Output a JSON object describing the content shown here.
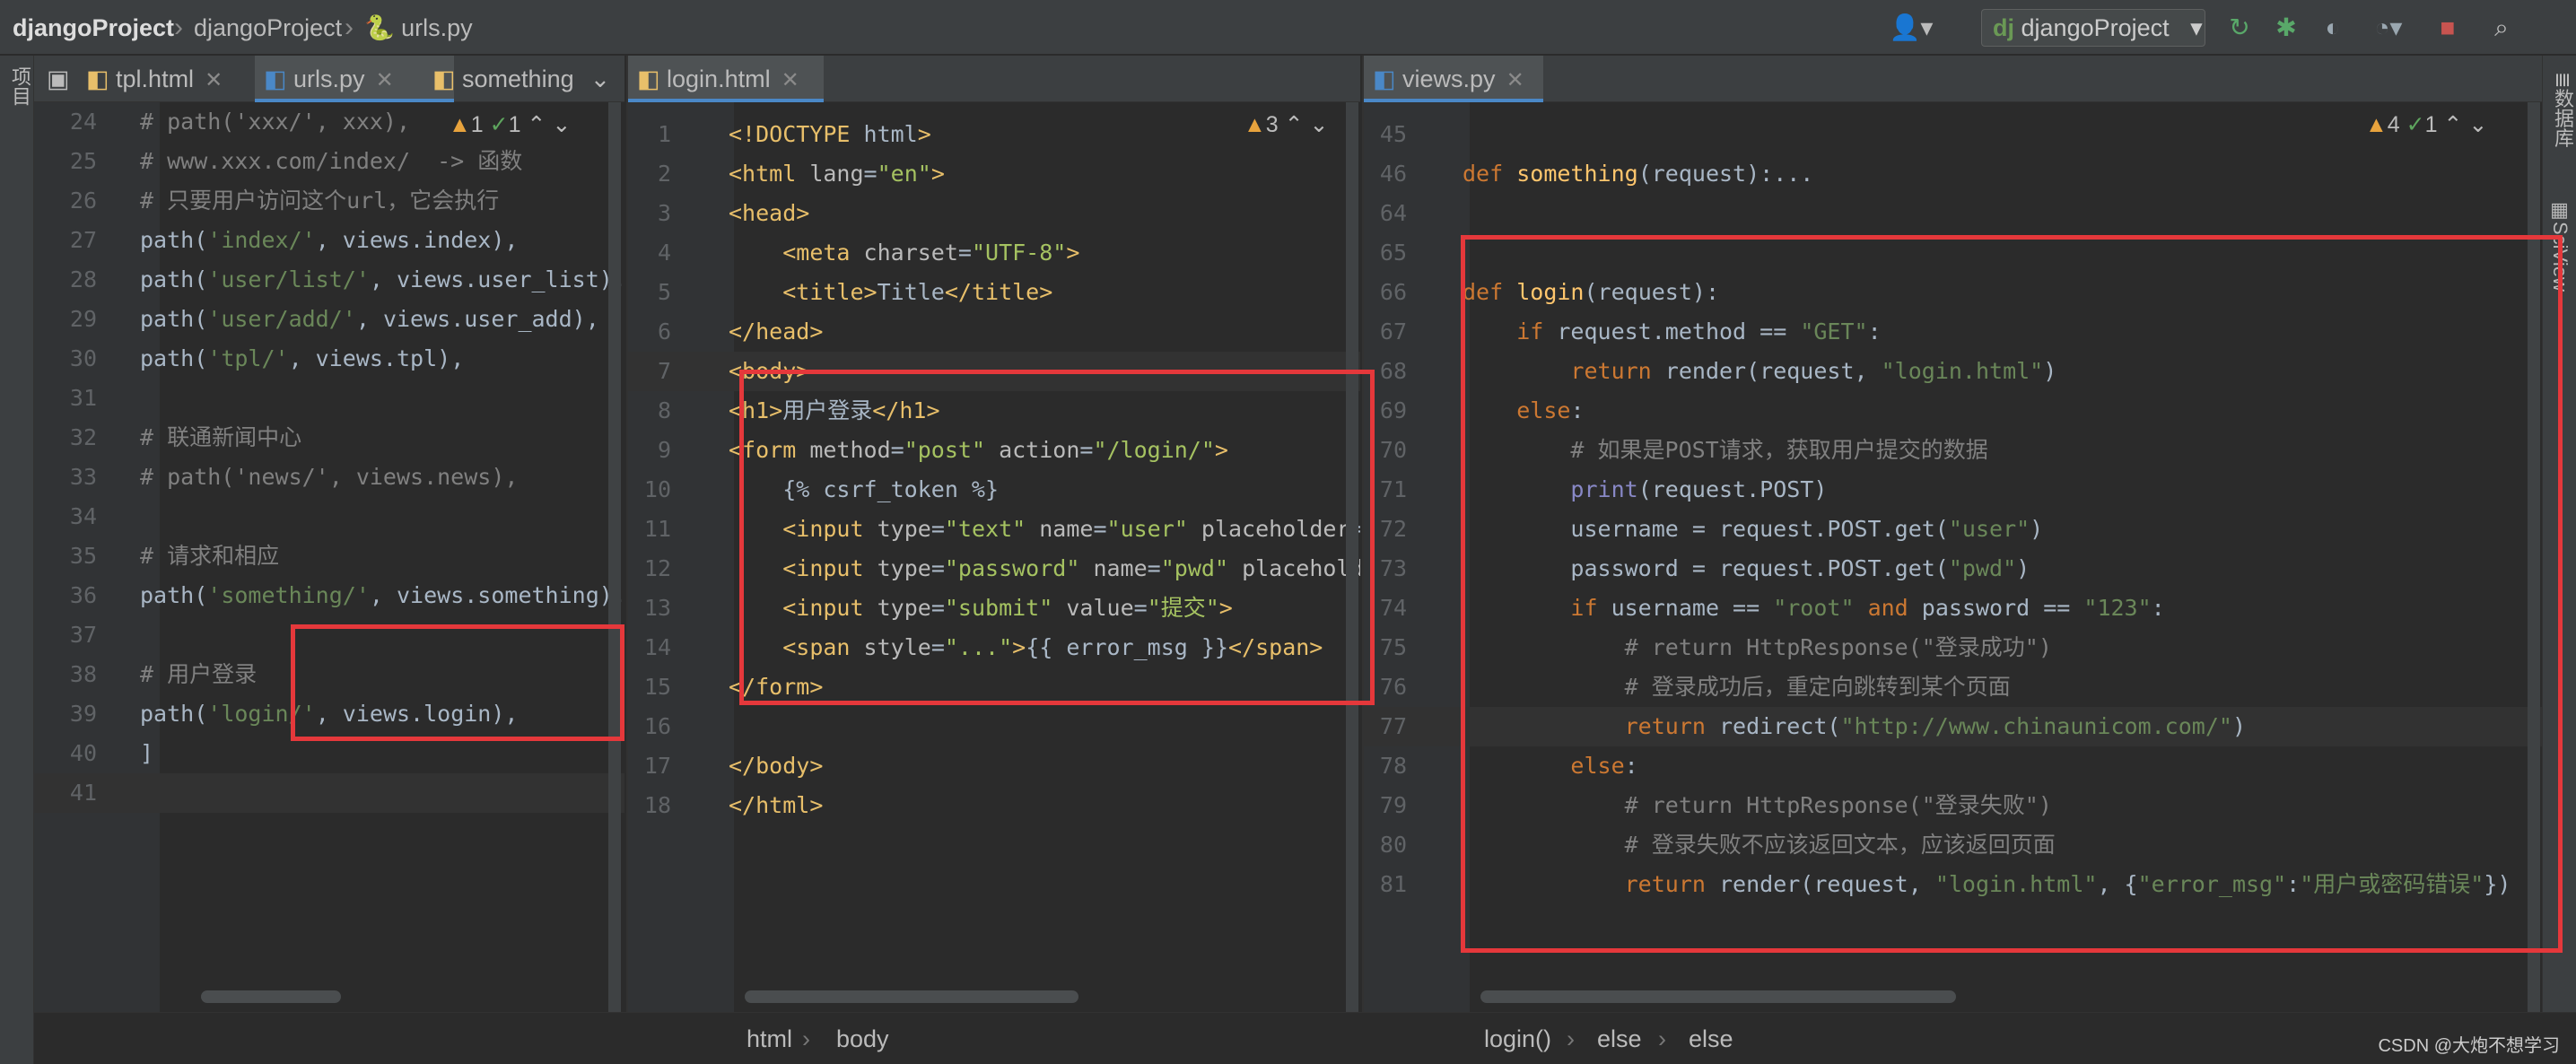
{
  "breadcrumb": {
    "project": "djangoProject",
    "folder": "djangoProject",
    "file": "urls.py"
  },
  "toolbar": {
    "run_config": "djangoProject",
    "user_icon": "user-icon",
    "run_icon": "rerun-icon",
    "debug_icon": "bug-icon",
    "coverage_icon": "coverage-icon",
    "profile_icon": "profile-icon",
    "stop_icon": "stop-icon",
    "search_icon": "search-icon"
  },
  "left_strip": {
    "project_label": "项目"
  },
  "right_strip": {
    "database_label": "数据库",
    "sciview_label": "SciView"
  },
  "panes": [
    {
      "tabs": [
        {
          "label": "tpl.html",
          "active": false
        },
        {
          "label": "urls.py",
          "active": true
        },
        {
          "label": "something",
          "active": false
        }
      ],
      "inspections": {
        "warnings": "1",
        "ok": "1"
      },
      "lines": [
        "24",
        "25",
        "26",
        "27",
        "28",
        "29",
        "30",
        "31",
        "32",
        "33",
        "34",
        "35",
        "36",
        "37",
        "38",
        "39",
        "40",
        "41"
      ]
    },
    {
      "tabs": [
        {
          "label": "login.html",
          "active": true
        }
      ],
      "inspections": {
        "warnings": "3"
      },
      "lines": [
        "1",
        "2",
        "3",
        "4",
        "5",
        "6",
        "7",
        "8",
        "9",
        "10",
        "11",
        "12",
        "13",
        "14",
        "15",
        "16",
        "17",
        "18"
      ],
      "breadcrumb": [
        "html",
        "body"
      ]
    },
    {
      "tabs": [
        {
          "label": "views.py",
          "active": true
        }
      ],
      "inspections": {
        "warnings": "4",
        "ok": "1"
      },
      "lines": [
        "45",
        "46",
        "64",
        "65",
        "66",
        "67",
        "68",
        "69",
        "70",
        "71",
        "72",
        "73",
        "74",
        "75",
        "76",
        "77",
        "78",
        "79",
        "80",
        "81"
      ],
      "breadcrumb": [
        "login()",
        "else",
        "else"
      ]
    }
  ],
  "code_urls": [
    "# path('xxx/', xxx),",
    "# www.xxx.com/index/  -> 函数",
    "# 只要用户访问这个url，它会执行",
    "path('index/', views.index),",
    "path('user/list/', views.user_list),",
    "path('user/add/', views.user_add),",
    "path('tpl/', views.tpl),",
    "",
    "# 联通新闻中心",
    "# path('news/', views.news),",
    "",
    "# 请求和相应",
    "path('something/', views.something),",
    "",
    "# 用户登录",
    "path('login/', views.login),",
    "]",
    ""
  ],
  "code_html": [
    "<!DOCTYPE html>",
    "<html lang=\"en\">",
    "<head>",
    "    <meta charset=\"UTF-8\">",
    "    <title>Title</title>",
    "</head>",
    "<body>",
    "<h1>用户登录</h1>",
    "<form method=\"post\" action=\"/login/\">",
    "    {% csrf_token %}",
    "    <input type=\"text\" name=\"user\" placeholder=\"用户名\">",
    "    <input type=\"password\" name=\"pwd\" placeholder=\"密码\">",
    "    <input type=\"submit\" value=\"提交\">",
    "    <span style=\"...\">{{ error_msg }}</span>",
    "</form>",
    "",
    "</body>",
    "</html>"
  ],
  "code_views": [
    "",
    "def something(request):...",
    "",
    "",
    "def login(request):",
    "    if request.method == \"GET\":",
    "        return render(request, \"login.html\")",
    "    else:",
    "        # 如果是POST请求，获取用户提交的数据",
    "        print(request.POST)",
    "        username = request.POST.get(\"user\")",
    "        password = request.POST.get(\"pwd\")",
    "        if username == \"root\" and password == \"123\":",
    "            # return HttpResponse(\"登录成功\")",
    "            # 登录成功后，重定向跳转到某个页面",
    "            return redirect(\"http://www.chinaunicom.com/\")",
    "        else:",
    "            # return HttpResponse(\"登录失败\")",
    "            # 登录失败不应该返回文本，应该返回页面",
    "            return render(request, \"login.html\", {\"error_msg\":\"用户或密码错误\"})"
  ],
  "watermark": "CSDN @大炮不想学习",
  "colors": {
    "keyword": "#cc7832",
    "string": "#6a8759",
    "comment": "#808080",
    "function": "#ffc66d",
    "tag": "#e8bf6a",
    "highlight_box": "#e5383b",
    "background": "#2b2b2b"
  }
}
